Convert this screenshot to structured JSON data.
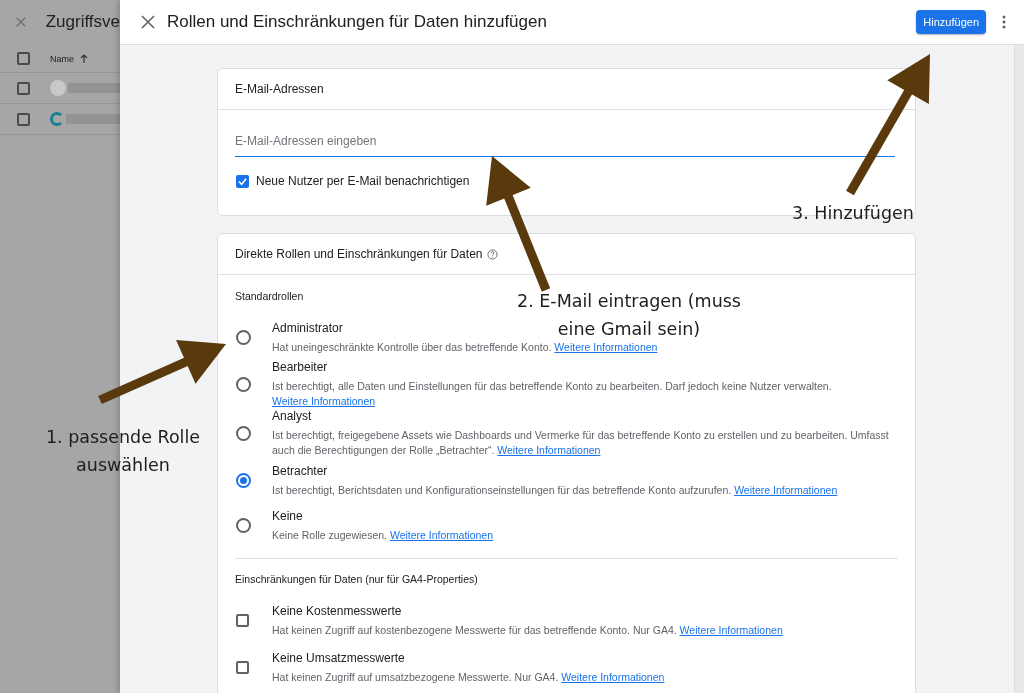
{
  "background_page": {
    "title": "Zugriffsve",
    "column": "Name",
    "header_checked": false,
    "rows": [
      {
        "kind": "person",
        "checked": false
      },
      {
        "kind": "logo",
        "checked": false
      }
    ]
  },
  "dialog": {
    "title": "Rollen und Einschränkungen für Daten hinzufügen",
    "add_button": "Hinzufügen",
    "email_card": {
      "title": "E-Mail-Adressen",
      "placeholder": "E-Mail-Adressen eingeben",
      "notify": {
        "label": "Neue Nutzer per E-Mail benachrichtigen",
        "checked": true
      }
    },
    "roles_card": {
      "title": "Direkte Rollen und Einschränkungen für Daten",
      "roles_heading": "Standardrollen",
      "roles": [
        {
          "title": "Administrator",
          "description": "Hat uneingeschränkte Kontrolle über das betreffende Konto.",
          "link": "Weitere Informationen",
          "selected": false
        },
        {
          "title": "Bearbeiter",
          "description": "Ist berechtigt, alle Daten und Einstellungen für das betreffende Konto zu bearbeiten. Darf jedoch keine Nutzer verwalten.",
          "link": "Weitere Informationen",
          "selected": false
        },
        {
          "title": "Analyst",
          "description": "Ist berechtigt, freigegebene Assets wie Dashboards und Vermerke für das betreffende Konto zu erstellen und zu bearbeiten. Umfasst auch die Berechtigungen der Rolle „Betrachter“.",
          "link": "Weitere Informationen",
          "selected": false
        },
        {
          "title": "Betrachter",
          "description": "Ist berechtigt, Berichtsdaten und Konfigurationseinstellungen für das betreffende Konto aufzurufen.",
          "link": "Weitere Informationen",
          "selected": true
        },
        {
          "title": "Keine",
          "description": "Keine Rolle zugewiesen.",
          "link": "Weitere Informationen",
          "selected": false
        }
      ],
      "restrictions_heading": "Einschränkungen für Daten (nur für GA4-Properties)",
      "restrictions": [
        {
          "title": "Keine Kostenmesswerte",
          "description": "Hat keinen Zugriff auf kostenbezogene Messwerte für das betreffende Konto. Nur GA4.",
          "link": "Weitere Informationen",
          "checked": false
        },
        {
          "title": "Keine Umsatzmesswerte",
          "description": "Hat keinen Zugriff auf umsatzbezogene Messwerte. Nur GA4.",
          "link": "Weitere Informationen",
          "checked": false
        }
      ]
    }
  },
  "annotations": [
    {
      "text": "1. passende Rolle auswählen"
    },
    {
      "text": "2. E-Mail eintragen (muss eine Gmail sein)"
    },
    {
      "text": "3. Hinzufügen"
    }
  ]
}
